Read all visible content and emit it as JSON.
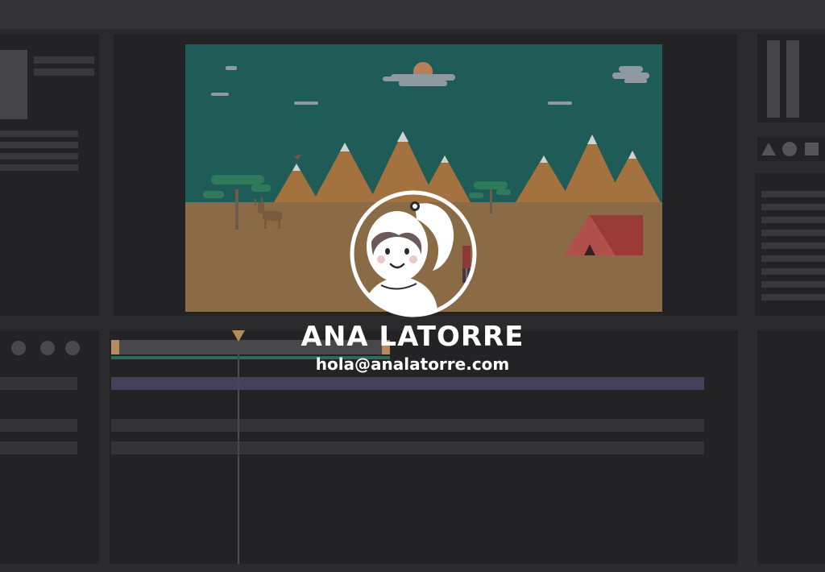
{
  "brand": {
    "name": "ANA LATORRE",
    "email": "hola@analatorre.com"
  },
  "icons": {
    "logo": "girl-avatar-logo",
    "shapes": [
      "triangle-icon",
      "circle-icon",
      "square-icon"
    ],
    "playhead": "playhead-icon"
  },
  "colors": {
    "sky": "#1f5c57",
    "ground": "#8a6b46",
    "mountain": "#a3723f",
    "snow": "#cfd2cf",
    "tent": "#9a3b38",
    "tree": "#2f7a5a",
    "timeline_accent": "#b58a5c",
    "timeline_green": "#2f6a56",
    "timeline_purple": "#44415a",
    "panel": "#232225",
    "background": "#2b2a2d"
  }
}
